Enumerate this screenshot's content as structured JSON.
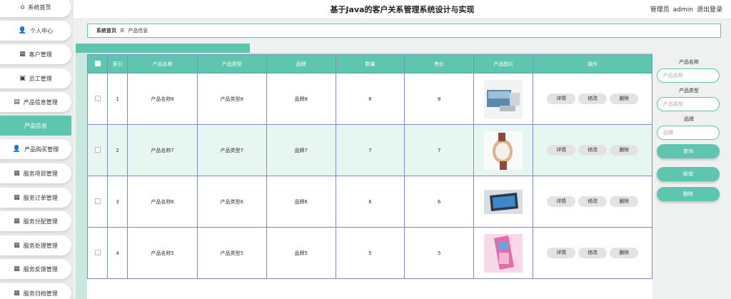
{
  "header": {
    "title": "基于Java的客户关系管理系统设计与实现",
    "user_role": "管理员",
    "username": "admin",
    "logout": "退出登录"
  },
  "sidebar": {
    "items": [
      {
        "icon": "⌂",
        "label": "系统首页"
      },
      {
        "icon": "👤",
        "label": "个人中心"
      },
      {
        "icon": "▦",
        "label": "客户管理"
      },
      {
        "icon": "▣",
        "label": "员工管理"
      },
      {
        "icon": "▤",
        "label": "产品信息管理"
      },
      {
        "icon": "",
        "label": "产品信息"
      },
      {
        "icon": "👤",
        "label": "产品购买管理"
      },
      {
        "icon": "▦",
        "label": "服务项目管理"
      },
      {
        "icon": "▦",
        "label": "服务订单管理"
      },
      {
        "icon": "▦",
        "label": "服务分配管理"
      },
      {
        "icon": "▦",
        "label": "服务处理管理"
      },
      {
        "icon": "▦",
        "label": "服务反馈管理"
      },
      {
        "icon": "▦",
        "label": "服务归档管理"
      }
    ]
  },
  "breadcrumb": {
    "home": "系统首页",
    "sep": "☰",
    "current": "产品信息"
  },
  "table": {
    "columns": [
      "索引",
      "产品名称",
      "产品类型",
      "品牌",
      "数量",
      "售价",
      "产品图片",
      "操作"
    ],
    "rows": [
      {
        "index": "1",
        "name": "产品名称8",
        "type": "产品类型8",
        "brand": "品牌8",
        "qty": "8",
        "price": "8"
      },
      {
        "index": "2",
        "name": "产品名称7",
        "type": "产品类型7",
        "brand": "品牌7",
        "qty": "7",
        "price": "7"
      },
      {
        "index": "3",
        "name": "产品名称6",
        "type": "产品类型6",
        "brand": "品牌6",
        "qty": "6",
        "price": "6"
      },
      {
        "index": "4",
        "name": "产品名称5",
        "type": "产品类型5",
        "brand": "品牌5",
        "qty": "5",
        "price": "5"
      }
    ],
    "actions": {
      "detail": "详情",
      "edit": "修改",
      "delete": "删除"
    }
  },
  "search": {
    "name_label": "产品名称",
    "name_placeholder": "产品名称",
    "type_label": "产品类型",
    "type_placeholder": "产品类型",
    "brand_label": "品牌",
    "brand_placeholder": "品牌",
    "query": "查询",
    "add": "新增",
    "delete": "删除"
  },
  "colors": {
    "accent": "#5ec6ae"
  }
}
